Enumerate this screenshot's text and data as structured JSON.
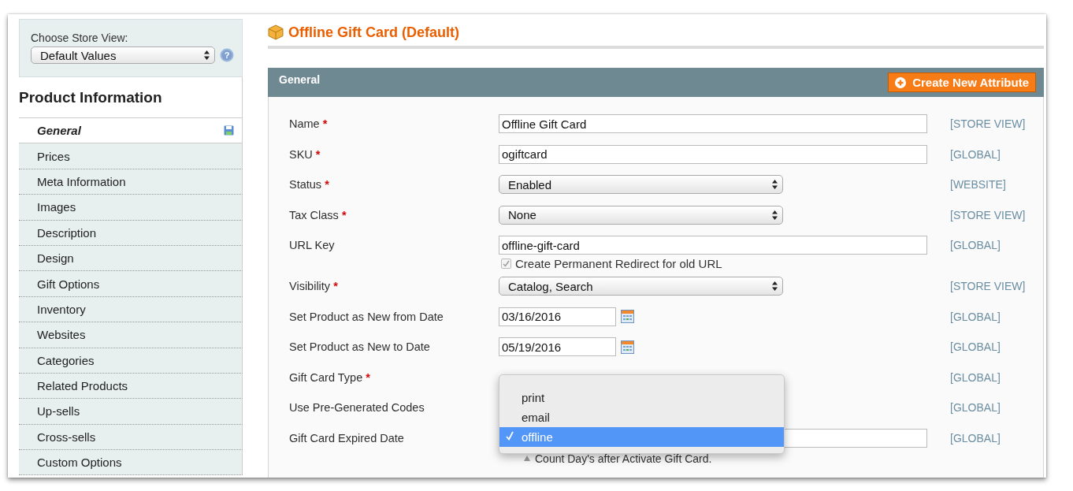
{
  "store_view": {
    "label": "Choose Store View:",
    "value": "Default Values",
    "help": "?"
  },
  "sidebar": {
    "title": "Product Information",
    "items": [
      {
        "label": "General",
        "selected": true,
        "changed": true
      },
      {
        "label": "Prices",
        "selected": false,
        "changed": false
      },
      {
        "label": "Meta Information",
        "selected": false,
        "changed": false
      },
      {
        "label": "Images",
        "selected": false,
        "changed": false
      },
      {
        "label": "Description",
        "selected": false,
        "changed": false
      },
      {
        "label": "Design",
        "selected": false,
        "changed": false
      },
      {
        "label": "Gift Options",
        "selected": false,
        "changed": false
      },
      {
        "label": "Inventory",
        "selected": false,
        "changed": false
      },
      {
        "label": "Websites",
        "selected": false,
        "changed": false
      },
      {
        "label": "Categories",
        "selected": false,
        "changed": false
      },
      {
        "label": "Related Products",
        "selected": false,
        "changed": false
      },
      {
        "label": "Up-sells",
        "selected": false,
        "changed": false
      },
      {
        "label": "Cross-sells",
        "selected": false,
        "changed": false
      },
      {
        "label": "Custom Options",
        "selected": false,
        "changed": false
      }
    ]
  },
  "page": {
    "title": "Offline Gift Card (Default)"
  },
  "section": {
    "title": "General",
    "button": "Create New Attribute"
  },
  "fields": [
    {
      "kind": "text",
      "label": "Name",
      "required_mark": "*",
      "value": "Offline Gift Card",
      "scope": "[STORE VIEW]"
    },
    {
      "kind": "text",
      "label": "SKU",
      "required_mark": "*",
      "value": "ogiftcard",
      "scope": "[GLOBAL]"
    },
    {
      "kind": "select",
      "label": "Status",
      "required_mark": "*",
      "value": "Enabled",
      "scope": "[WEBSITE]"
    },
    {
      "kind": "select",
      "label": "Tax Class",
      "required_mark": "*",
      "value": "None",
      "scope": "[STORE VIEW]"
    },
    {
      "kind": "text",
      "label": "URL Key",
      "value": "offline-gift-card",
      "scope": "[GLOBAL]",
      "checkbox": {
        "label": "Create Permanent Redirect for old URL",
        "checked": true
      }
    },
    {
      "kind": "select",
      "label": "Visibility",
      "required_mark": "*",
      "value": "Catalog, Search",
      "scope": "[STORE VIEW]"
    },
    {
      "kind": "date",
      "label": "Set Product as New from Date",
      "value": "03/16/2016",
      "scope": "[GLOBAL]"
    },
    {
      "kind": "date",
      "label": "Set Product as New to Date",
      "value": "05/19/2016",
      "scope": "[GLOBAL]"
    },
    {
      "kind": "dropdown",
      "label": "Gift Card Type",
      "required_mark": "*",
      "scope": "[GLOBAL]",
      "options": [
        {
          "label": "print",
          "selected": false
        },
        {
          "label": "email",
          "selected": false
        },
        {
          "label": "offline",
          "selected": true
        }
      ]
    },
    {
      "kind": "covered",
      "label": "Use Pre-Generated Codes",
      "scope": "[GLOBAL]"
    },
    {
      "kind": "text",
      "label": "Gift Card Expired Date",
      "scope": "[GLOBAL]",
      "note": "Count Day's after Activate Gift Card."
    }
  ]
}
